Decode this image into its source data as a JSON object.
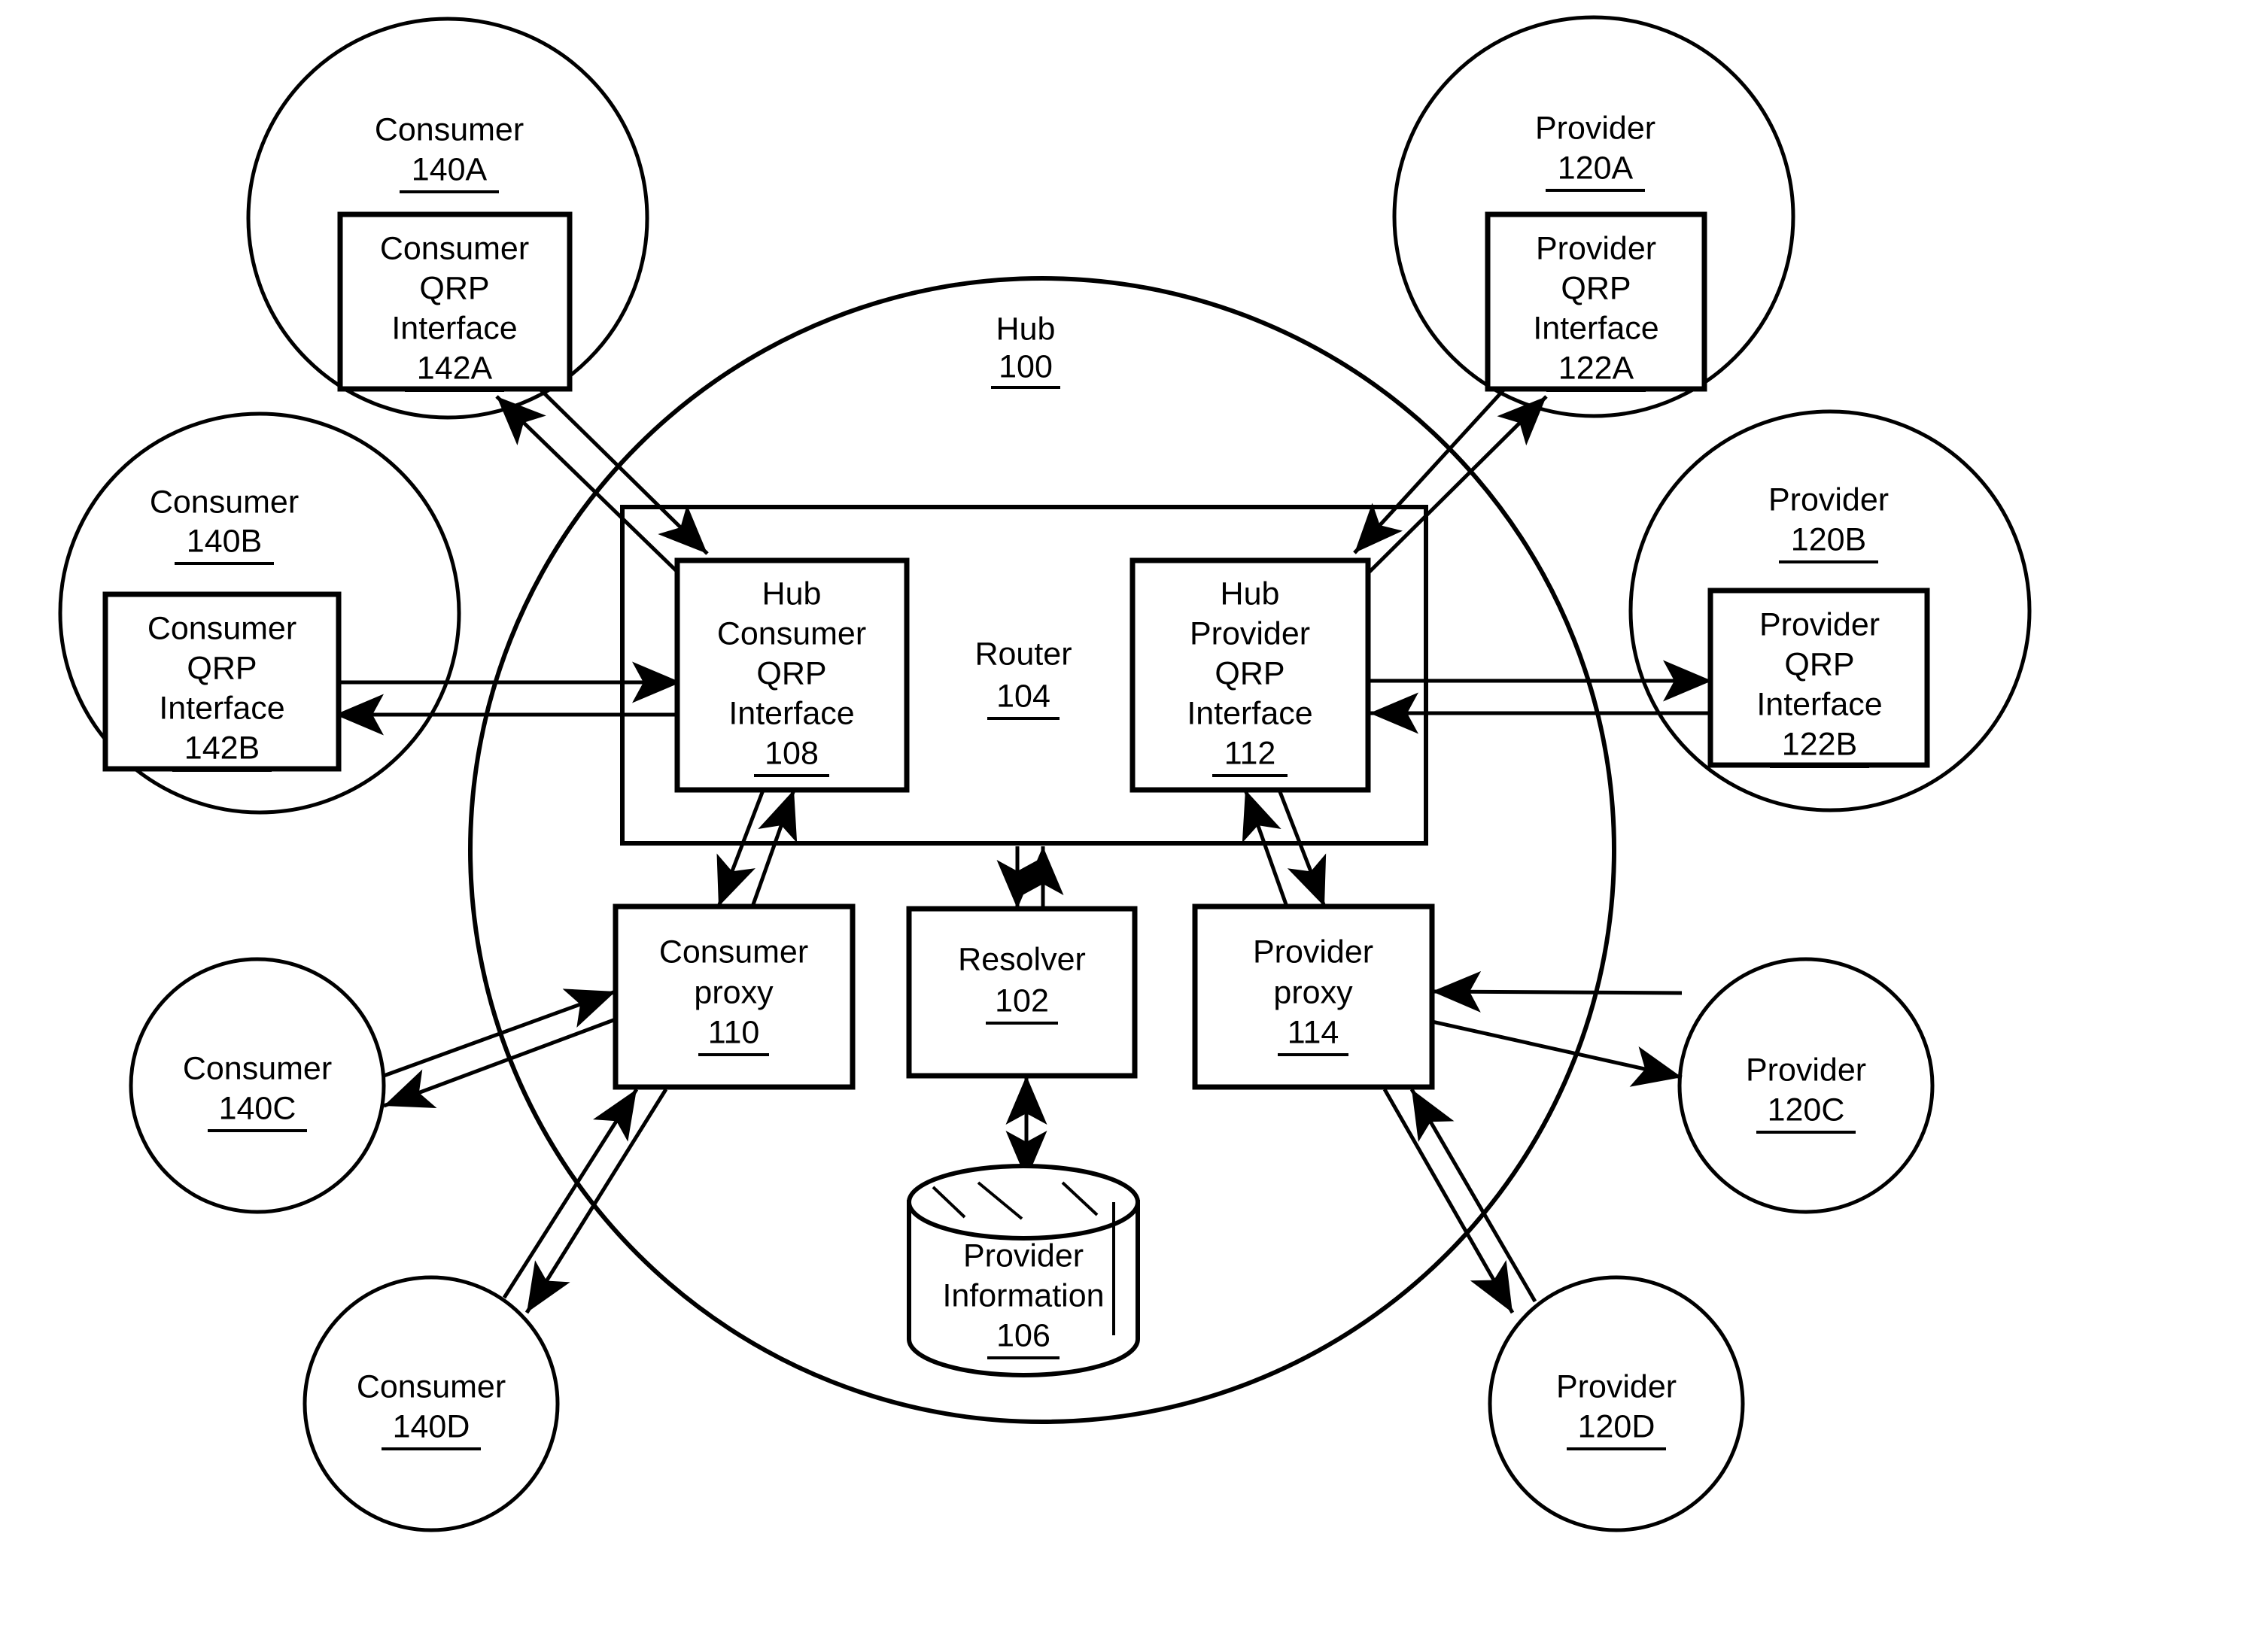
{
  "figure": {
    "type": "patent-block-diagram",
    "description": "Hub-and-spoke architecture diagram showing consumers, providers, QRP interfaces, router, proxies, resolver, and provider information store."
  },
  "hub": {
    "title": "Hub",
    "ref": "100",
    "router": {
      "title": "Router",
      "ref": "104"
    },
    "hub_consumer_qrp_interface": {
      "line1": "Hub",
      "line2": "Consumer",
      "line3": "QRP",
      "line4": "Interface",
      "ref": "108"
    },
    "hub_provider_qrp_interface": {
      "line1": "Hub",
      "line2": "Provider",
      "line3": "QRP",
      "line4": "Interface",
      "ref": "112"
    },
    "consumer_proxy": {
      "line1": "Consumer",
      "line2": "proxy",
      "ref": "110"
    },
    "provider_proxy": {
      "line1": "Provider",
      "line2": "proxy",
      "ref": "114"
    },
    "resolver": {
      "title": "Resolver",
      "ref": "102"
    },
    "provider_information": {
      "line1": "Provider",
      "line2": "Information",
      "ref": "106"
    }
  },
  "consumers": [
    {
      "id": "140A",
      "title": "Consumer",
      "ref": "140A",
      "interface": {
        "line1": "Consumer",
        "line2": "QRP",
        "line3": "Interface",
        "ref": "142A"
      }
    },
    {
      "id": "140B",
      "title": "Consumer",
      "ref": "140B",
      "interface": {
        "line1": "Consumer",
        "line2": "QRP",
        "line3": "Interface",
        "ref": "142B"
      }
    },
    {
      "id": "140C",
      "title": "Consumer",
      "ref": "140C",
      "interface": null
    },
    {
      "id": "140D",
      "title": "Consumer",
      "ref": "140D",
      "interface": null
    }
  ],
  "providers": [
    {
      "id": "120A",
      "title": "Provider",
      "ref": "120A",
      "interface": {
        "line1": "Provider",
        "line2": "QRP",
        "line3": "Interface",
        "ref": "122A"
      }
    },
    {
      "id": "120B",
      "title": "Provider",
      "ref": "120B",
      "interface": {
        "line1": "Provider",
        "line2": "QRP",
        "line3": "Interface",
        "ref": "122B"
      }
    },
    {
      "id": "120C",
      "title": "Provider",
      "ref": "120C",
      "interface": null
    },
    {
      "id": "120D",
      "title": "Provider",
      "ref": "120D",
      "interface": null
    }
  ],
  "colors": {
    "stroke": "#000000",
    "background": "#ffffff"
  }
}
